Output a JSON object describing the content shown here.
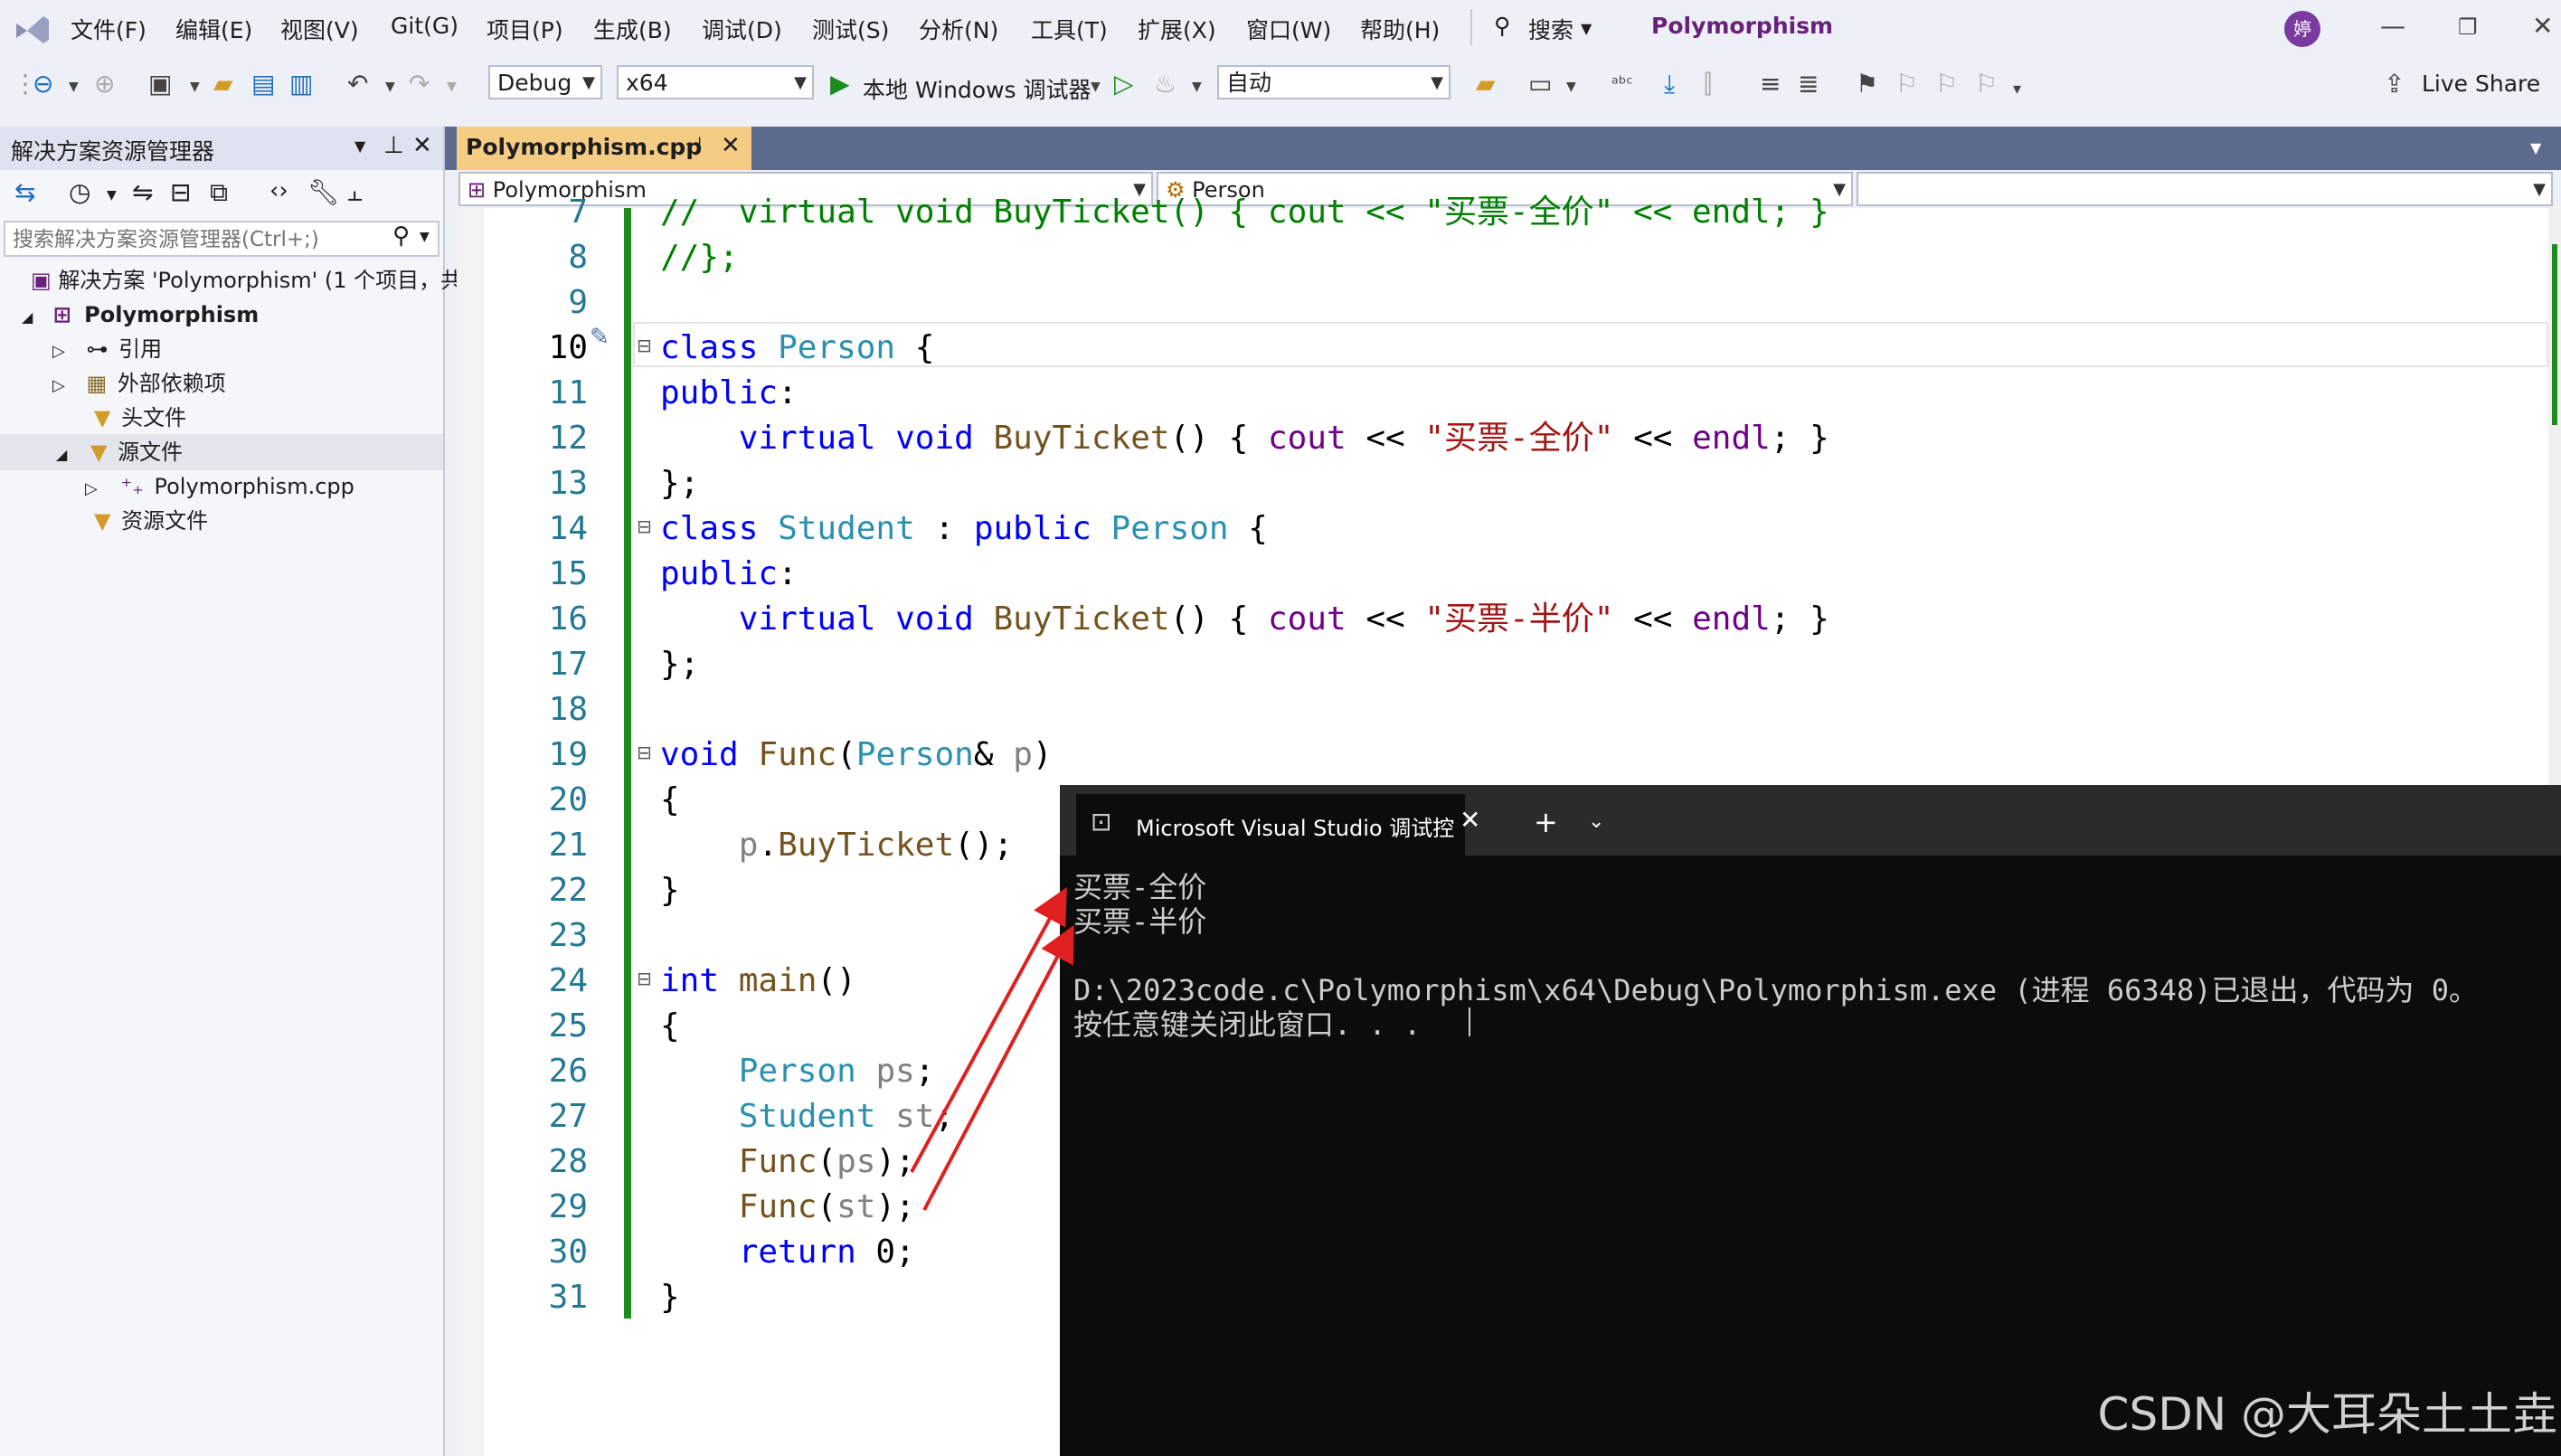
{
  "menubar": {
    "items": [
      "文件(F)",
      "编辑(E)",
      "视图(V)",
      "Git(G)",
      "项目(P)",
      "生成(B)",
      "调试(D)",
      "测试(S)",
      "分析(N)",
      "工具(T)",
      "扩展(X)",
      "窗口(W)",
      "帮助(H)"
    ],
    "search_label": "搜索",
    "project_title": "Polymorphism",
    "avatar_initial": "婷"
  },
  "toolbar": {
    "config": "Debug",
    "platform": "x64",
    "run_label": "本地 Windows 调试器",
    "auto_combo": "自动",
    "live_share": "Live Share"
  },
  "solution_explorer": {
    "title": "解决方案资源管理器",
    "search_placeholder": "搜索解决方案资源管理器(Ctrl+;)",
    "solution_label": "解决方案 'Polymorphism' (1 个项目，共",
    "project": "Polymorphism",
    "nodes": [
      "引用",
      "外部依赖项",
      "头文件",
      "源文件",
      "Polymorphism.cpp",
      "资源文件"
    ]
  },
  "editor": {
    "tab_name": "Polymorphism.cpp",
    "nav_scope": "Polymorphism",
    "nav_class": "Person",
    "nav_member": "",
    "line_numbers": [
      "7",
      "8",
      "9",
      "10",
      "11",
      "12",
      "13",
      "14",
      "15",
      "16",
      "17",
      "18",
      "19",
      "20",
      "21",
      "22",
      "23",
      "24",
      "25",
      "26",
      "27",
      "28",
      "29",
      "30",
      "31"
    ],
    "code_lines": [
      "//  virtual void BuyTicket() { cout << \"买票-全价\" << endl; }",
      "//};",
      "",
      "class Person {",
      "public:",
      "    virtual void BuyTicket() { cout << \"买票-全价\" << endl; }",
      "};",
      "class Student : public Person {",
      "public:",
      "    virtual void BuyTicket() { cout << \"买票-半价\" << endl; }",
      "};",
      "",
      "void Func(Person& p)",
      "{",
      "    p.BuyTicket();",
      "}",
      "",
      "int main()",
      "{",
      "    Person ps;",
      "    Student st;",
      "    Func(ps);",
      "    Func(st);",
      "    return 0;",
      "}"
    ]
  },
  "terminal": {
    "tab_title": "Microsoft Visual Studio 调试控",
    "lines": [
      "买票-全价",
      "买票-半价",
      "",
      "D:\\2023code.c\\Polymorphism\\x64\\Debug\\Polymorphism.exe (进程 66348)已退出，代码为 0。",
      "按任意键关闭此窗口. . ."
    ]
  },
  "watermark": "CSDN @大耳朵土土垚",
  "colors": {
    "accent_tab": "#f5cc84",
    "tabstrip": "#5c6a8e",
    "keyword": "#0000ff",
    "type": "#2b91af",
    "string": "#a31515",
    "arrow": "#e02020"
  }
}
